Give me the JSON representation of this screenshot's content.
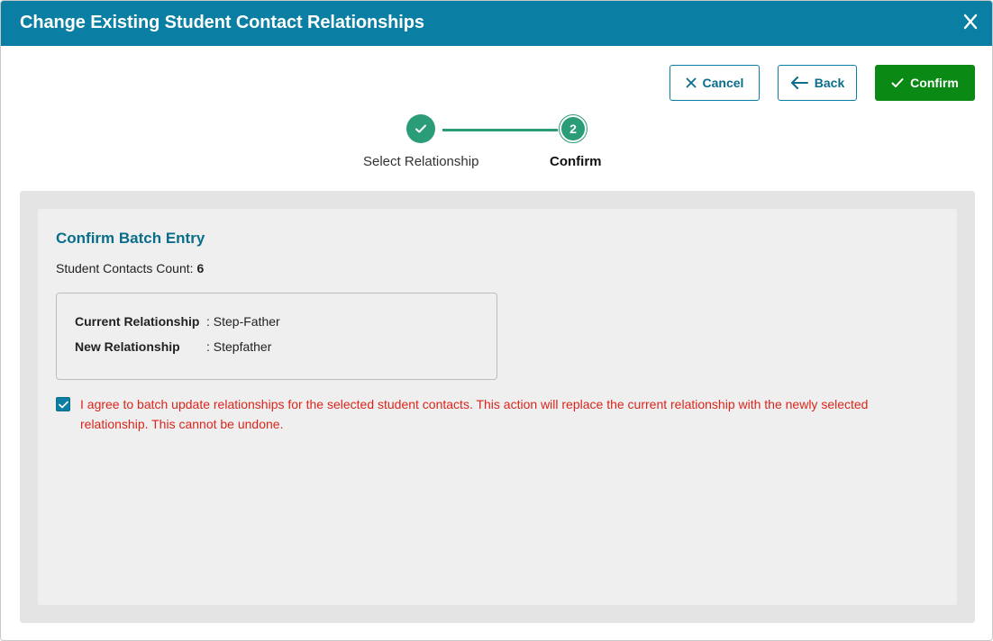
{
  "header": {
    "title": "Change Existing Student Contact Relationships"
  },
  "toolbar": {
    "cancel_label": "Cancel",
    "back_label": "Back",
    "confirm_label": "Confirm"
  },
  "stepper": {
    "steps": [
      {
        "label": "Select Relationship",
        "state": "completed"
      },
      {
        "label": "Confirm",
        "number": "2",
        "state": "current"
      }
    ]
  },
  "confirm": {
    "title": "Confirm Batch Entry",
    "count_label": "Student Contacts Count:",
    "count_value": "6",
    "current_label": "Current Relationship",
    "current_value": ": Step-Father",
    "new_label": "New Relationship",
    "new_value": ": Stepfather",
    "agree_checked": true,
    "agree_text": "I agree to batch update relationships for the selected student contacts. This action will replace the current relationship with the newly selected relationship. This cannot be undone."
  },
  "colors": {
    "header": "#0a7fa3",
    "accent": "#2a9c78",
    "confirm_button": "#0a8a15",
    "warning_text": "#d9261c"
  },
  "icons": {
    "close": "close-icon",
    "cancel": "x-icon",
    "back": "arrow-left-icon",
    "confirm": "check-icon"
  }
}
